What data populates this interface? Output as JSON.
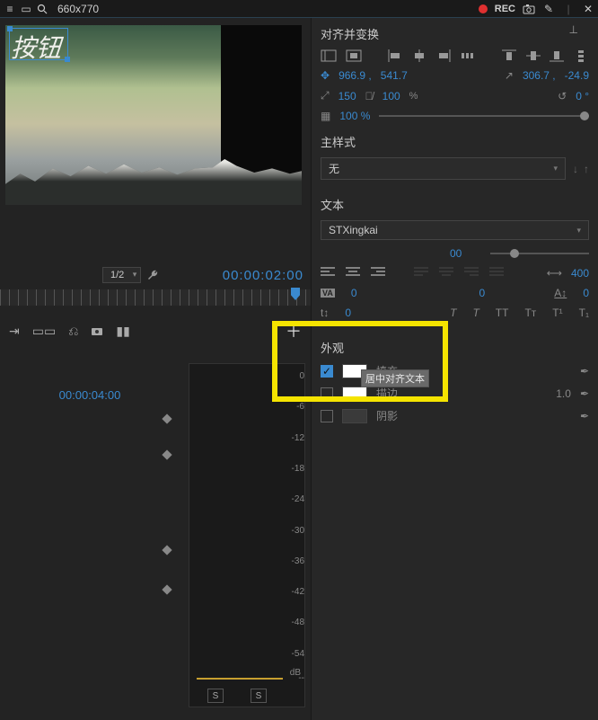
{
  "topbar": {
    "dimensions": "660x770",
    "rec_label": "REC"
  },
  "preview": {
    "text_overlay": "按钮"
  },
  "below_preview": {
    "ratio": "1/2",
    "timecode": "00:00:02:00"
  },
  "timeline": {
    "timecode": "00:00:04:00",
    "db_scale": [
      "0",
      "-6",
      "-12",
      "-18",
      "-24",
      "-30",
      "-36",
      "-42",
      "-48",
      "-54",
      "--"
    ],
    "db_label": "dB",
    "s_btn": "S"
  },
  "panel": {
    "align_transform": {
      "title": "对齐并变换",
      "pos_x": "966.9 ,",
      "pos_y": "541.7",
      "anchor_x": "306.7 ,",
      "anchor_y": "-24.9",
      "scale_w": "150",
      "scale_h": "100",
      "pct": "%",
      "rot": "0 °",
      "opacity": "100 %"
    },
    "master_style": {
      "title": "主样式",
      "value": "无"
    },
    "text": {
      "title": "文本",
      "font": "STXingkai",
      "weight_partial": "00",
      "tracking": "400",
      "va": "VA",
      "va_val": "0",
      "tooltip": "居中对齐文本",
      "kern_val": "0",
      "baseline_val": "0",
      "leading_val": "0"
    },
    "appearance": {
      "title": "外观",
      "fill": "填充",
      "stroke": "描边",
      "stroke_val": "1.0",
      "shadow": "阴影"
    }
  }
}
